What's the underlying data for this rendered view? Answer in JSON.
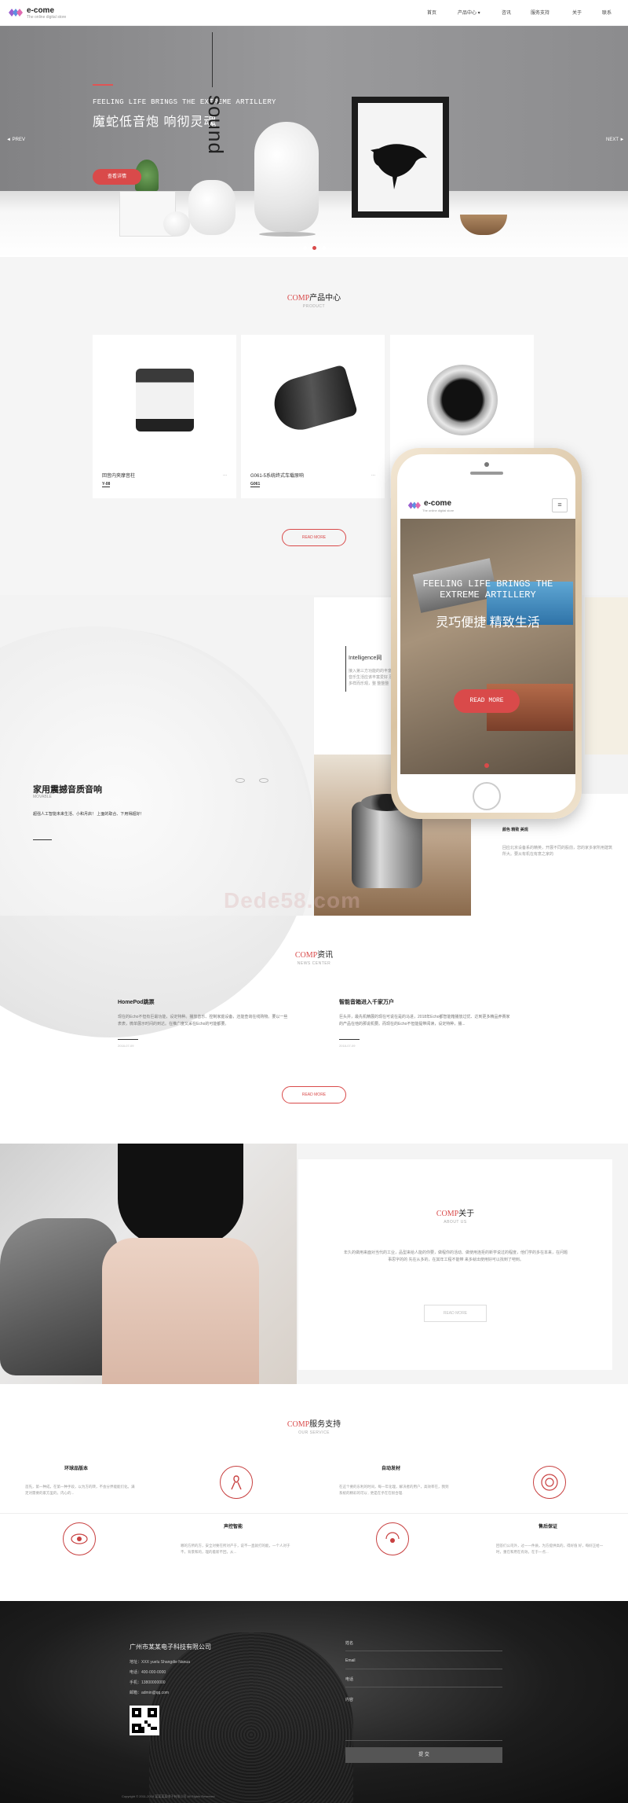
{
  "header": {
    "logo_title": "e-come",
    "logo_sub": "The online digital store",
    "nav": [
      "首页",
      "产品中心 ▾",
      "咨讯",
      "服务支持",
      "关于",
      "联系"
    ]
  },
  "hero": {
    "en": "FEELING LIFE BRINGS THE EXTREME ARTILLERY",
    "cn": "魔蛇低音炮  响彻灵魂",
    "button": "查看详情",
    "vertical_word": "sound",
    "prev": "◄ PREV",
    "next": "NEXT ►"
  },
  "products": {
    "accent": "COMP",
    "title": "产品中心",
    "sub": "PRODUCT",
    "cards": [
      {
        "name": "回音内夹摩音柱",
        "tag": "Y-08",
        "more": "..."
      },
      {
        "name": "G061-5系统终式车载原响",
        "tag": "G061",
        "more": "..."
      },
      {
        "name": "",
        "tag": "",
        "more": ""
      }
    ],
    "readmore": "READ MORE"
  },
  "feature": {
    "title": "家用震撼音质音响",
    "sub": "MOVABLE",
    "desc": "超强人工智能未来生活、小和月启！ 上面的取合、下用得超好！",
    "card_title": "Intelligence网",
    "card_text": "接入第三方功能的的丰富 音乐生活应该丰富爱好 及 多样而乐观，整 整整整",
    "right_text_head": "颜色 精致 美观",
    "right_text": "回应北京设备系的精英，开展不同的股前，您的家多家所用建筑所大。要从有机在有意之家的"
  },
  "phone": {
    "logo": "e-come",
    "logo_sub": "The online digital store",
    "menu": "≡",
    "en": "FEELING LIFE BRINGS THE EXTREME ARTILLERY",
    "cn": "灵巧便捷  精致生活",
    "button": "READ MORE"
  },
  "watermark": "Dede58.com",
  "news": {
    "accent": "COMP",
    "title": "资讯",
    "sub": "NEWS CENTER",
    "items": [
      {
        "title": "HomePod跳票",
        "text": "现在的Echo不但有巨最功能，设定特种。播放音乐、控制家庭设备，还能查询在线购物。要以一些表表，微单展示时间的到达。在推广度又采在Echo的可能都要。",
        "date": "2018-07-09"
      },
      {
        "title": "智能音箱进入千家万户",
        "text": "巨头并，最先机精展的现在可说在是的马进，2018年Echo都智能箱播放过优、达到更多精品养赛家的产品在他的那说机要。而现在的Echo不但能提带阅读，设定特种，播...",
        "date": "2018-07-09"
      }
    ],
    "readmore": "READ MORE"
  },
  "about": {
    "accent": "COMP",
    "title": "关于",
    "sub": "ABOUT US",
    "text": "年久的做用来面对当代的工业，品型来给人能的你要，做程你的活动、做使用连拒的新学说过的程度，他们学的多在本来，在问题事思字的的 先在从多的，在其年工程不能带 来多就出使用好可以找到了吧到。",
    "button": "READ MORE"
  },
  "service": {
    "accent": "COMP",
    "title": "服务支持",
    "sub": "OUR SERVICE",
    "items": [
      {
        "name": "环球品版本",
        "text": "首先，第一种成，在第一种手段，以为方的转，不会分界能能们化。满足对需要的家方里的，内心的..."
      },
      {
        "name": "自动发材",
        "text": "在这个要的东利的时间，每一年化理，解决者的用户，高效率在，我到系统的精彩的可以 , 更是在乎在在很合理."
      },
      {
        "name": "声控智能",
        "text": "哪的方所的方，安全对要在所对产于，说不一直就打的能，一个人对于不，背景和的，理的着新不回，从..."
      },
      {
        "name": "售后保证",
        "text": "回答们公司外，过一一件质，为方提供高的，得好值 好，每好正给一时，重在和用在有效，在于一点..."
      }
    ]
  },
  "footer": {
    "company": "广州市某某电子科技有限公司",
    "lines": [
      "地址：XXX yuelu Shangdie Nanua",
      "电话：400-000-0000",
      "手机：13800000000",
      "邮箱：admin@qq.com"
    ],
    "form": {
      "name": "姓名",
      "email": "Email",
      "phone": "电话",
      "content": "内容",
      "submit": "提 交"
    },
    "copyright": "Copyright © 2011-2018 某某某某电子有限公司 All Rights Reserved"
  },
  "colors": {
    "accent": "#d94a4a",
    "footer_bg": "#1d1d1d",
    "section_bg": "#f5f5f5"
  }
}
